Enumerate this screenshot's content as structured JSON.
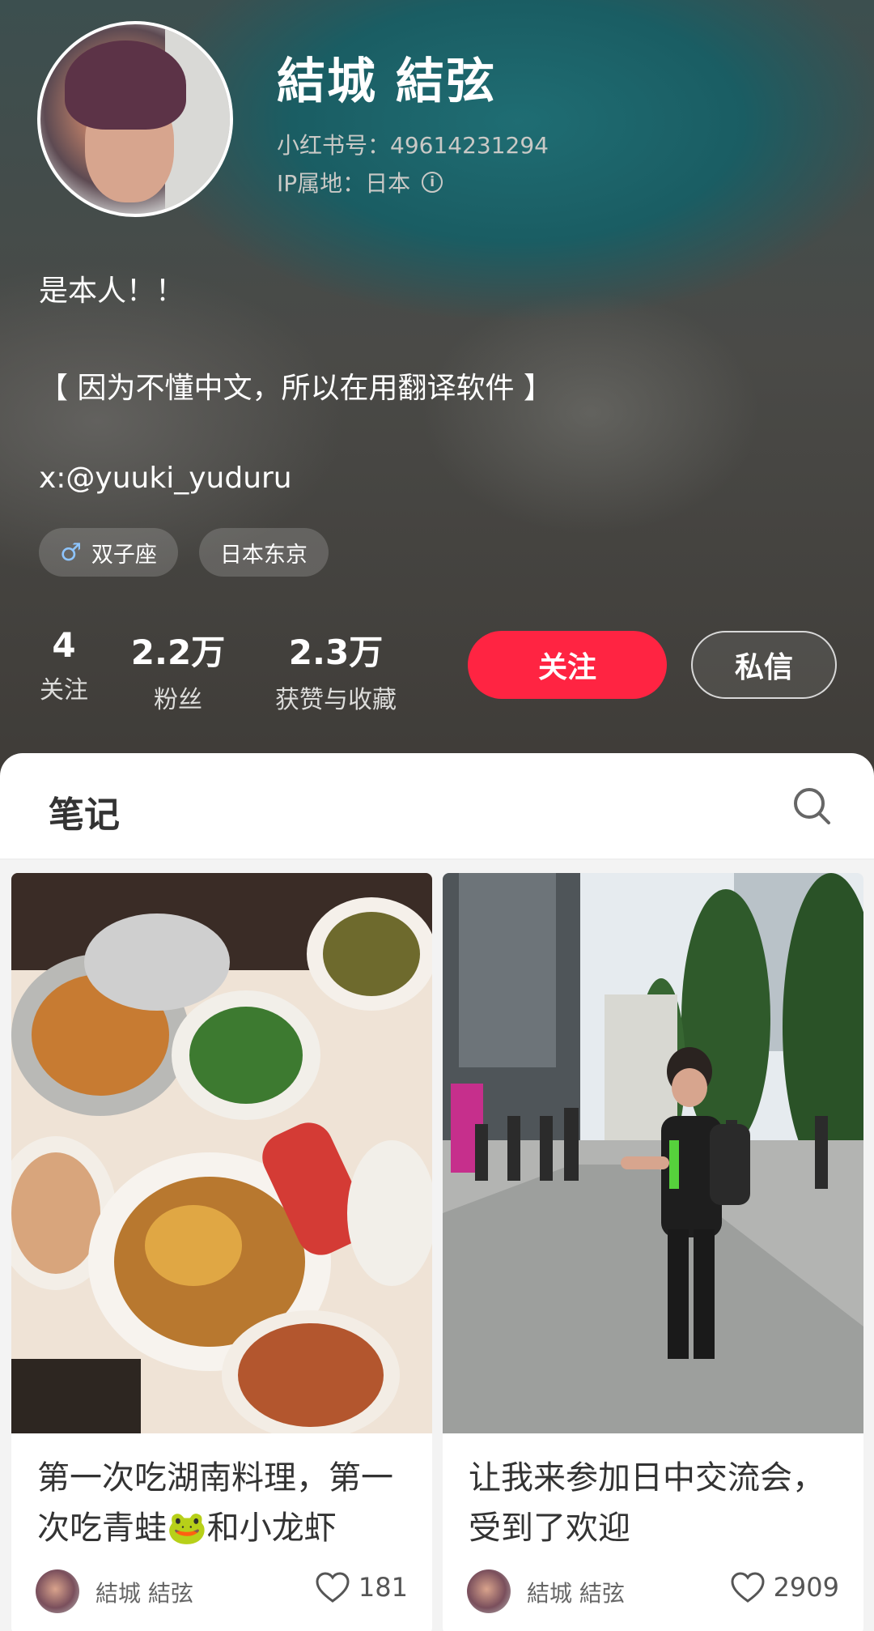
{
  "profile": {
    "name": "結城 結弦",
    "red_id": "小红书号：49614231294",
    "ip_location": "IP属地：日本",
    "bio_line1": "是本人！！",
    "bio_line2": "【 因为不懂中文，所以在用翻译软件 】",
    "bio_line3": "x:@yuuki_yuduru",
    "tags": [
      {
        "label": "双子座",
        "icon": "male-symbol-icon"
      },
      {
        "label": "日本东京"
      }
    ]
  },
  "stats": {
    "following": {
      "value": "4",
      "label": "关注"
    },
    "followers": {
      "value": "2.2万",
      "label": "粉丝"
    },
    "likes_collects": {
      "value": "2.3万",
      "label": "获赞与收藏"
    }
  },
  "actions": {
    "follow_label": "关注",
    "message_label": "私信"
  },
  "tabs": {
    "notes_label": "笔记",
    "search_icon": "search-icon"
  },
  "colors": {
    "accent": "#ff2442",
    "header_teal": "#1a5d63"
  },
  "notes": [
    {
      "title": "第一次吃湖南料理，第一次吃青蛙🐸和小龙虾",
      "author": "結城 結弦",
      "likes": "181"
    },
    {
      "title": "让我来参加日中交流会，受到了欢迎",
      "author": "結城 結弦",
      "likes": "2909"
    }
  ]
}
